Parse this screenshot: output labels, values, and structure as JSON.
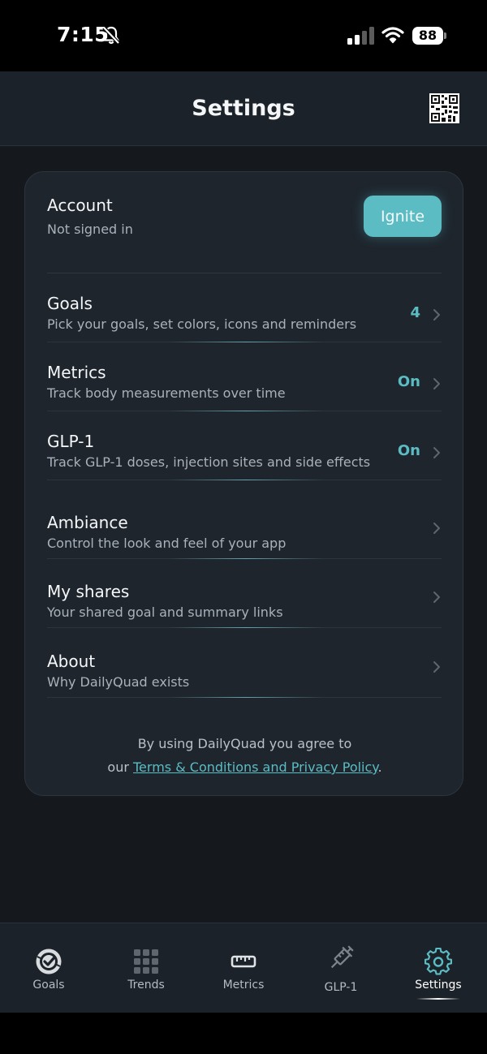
{
  "status_bar": {
    "time": "7:15",
    "battery": "88",
    "icons": [
      "bell-muted-icon",
      "cellular-signal-icon",
      "wifi-icon",
      "battery-icon"
    ]
  },
  "header": {
    "title": "Settings",
    "action_icon": "qr-code-icon"
  },
  "account": {
    "title": "Account",
    "subtitle": "Not signed in",
    "button_label": "Ignite"
  },
  "settings_rows": [
    {
      "title": "Goals",
      "subtitle": "Pick your goals, set colors, icons and reminders",
      "value": "4"
    },
    {
      "title": "Metrics",
      "subtitle": "Track body measurements over time",
      "value": "On"
    },
    {
      "title": "GLP-1",
      "subtitle": "Track GLP-1 doses, injection sites and side effects",
      "value": "On"
    },
    {
      "title": "Ambiance",
      "subtitle": "Control the look and feel of your app",
      "value": ""
    },
    {
      "title": "My shares",
      "subtitle": "Your shared goal and summary links",
      "value": ""
    },
    {
      "title": "About",
      "subtitle": "Why DailyQuad exists",
      "value": ""
    }
  ],
  "terms": {
    "line1": "By using DailyQuad you agree to",
    "prefix": "our ",
    "link": "Terms & Conditions and Privacy Policy",
    "suffix": "."
  },
  "tab_bar": {
    "tabs": [
      {
        "label": "Goals",
        "icon": "goals-check-icon"
      },
      {
        "label": "Trends",
        "icon": "grid-icon"
      },
      {
        "label": "Metrics",
        "icon": "ruler-icon"
      },
      {
        "label": "GLP-1",
        "icon": "syringe-icon"
      },
      {
        "label": "Settings",
        "icon": "gear-icon"
      }
    ],
    "active": "Settings"
  },
  "colors": {
    "accent": "#5bbcc3",
    "background": "#15191e",
    "card": "#1e252d",
    "header": "#1c2229"
  }
}
